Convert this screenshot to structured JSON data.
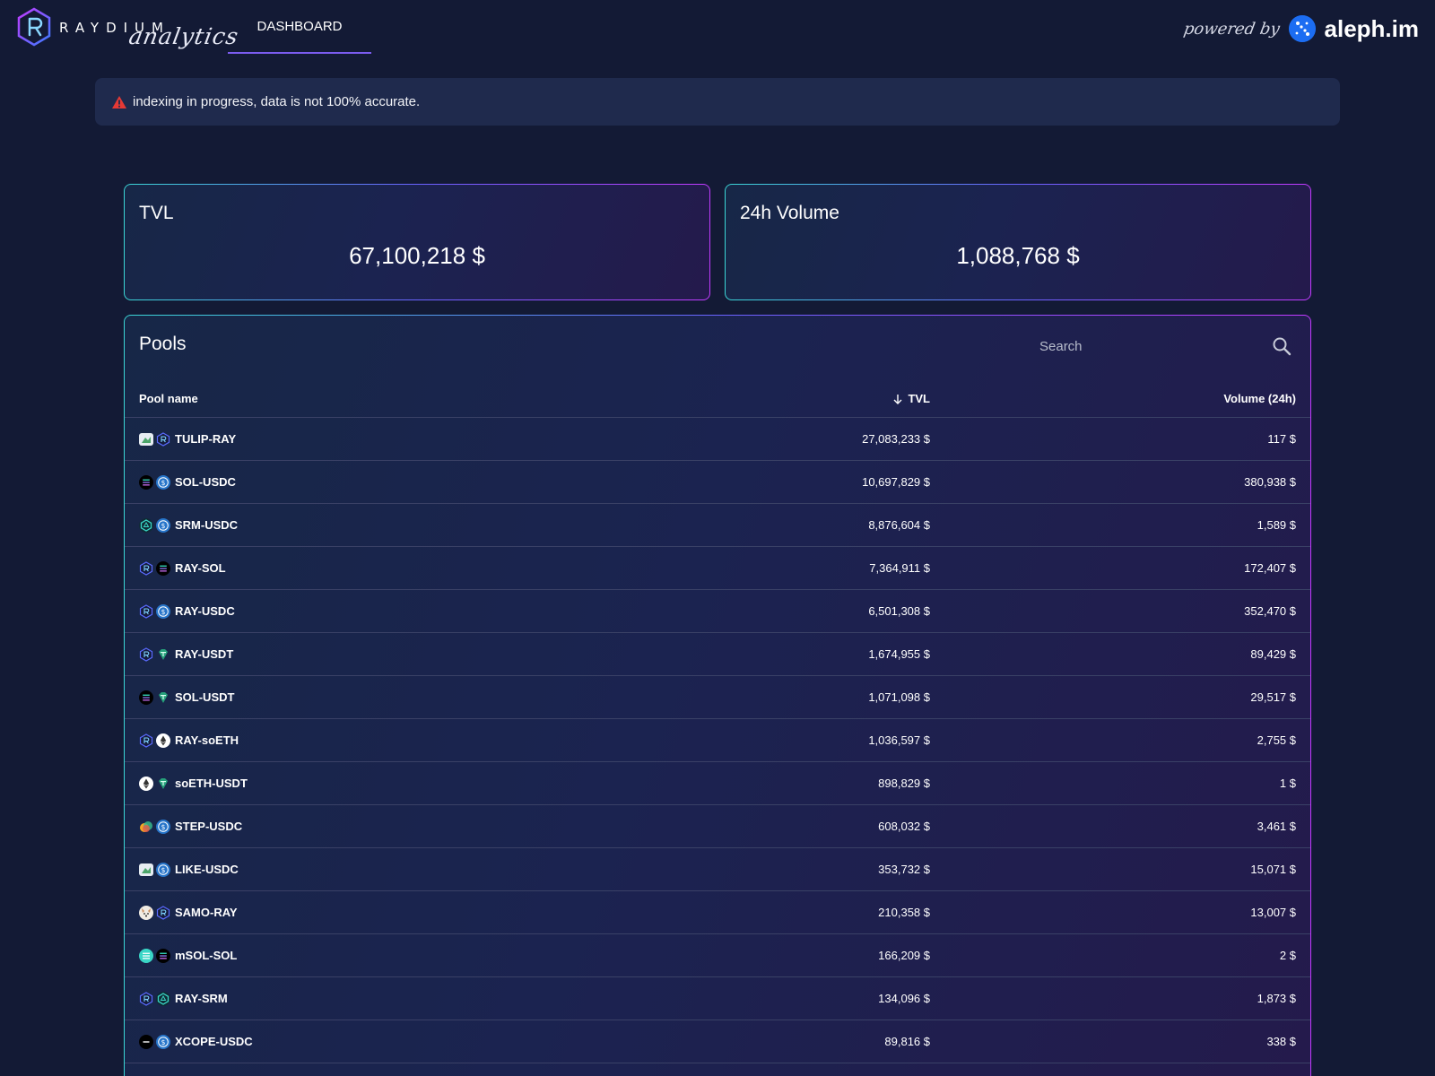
{
  "header": {
    "logo_word": "RAYDIUM",
    "logo_script": "analytics",
    "tab_label": "DASHBOARD",
    "powered_by": "powered by",
    "partner": "aleph.im"
  },
  "alert": {
    "icon": "warning-icon",
    "text": "indexing in progress, data is not 100% accurate."
  },
  "stats": {
    "tvl": {
      "label": "TVL",
      "value": "67,100,218 $"
    },
    "volume": {
      "label": "24h Volume",
      "value": "1,088,768 $"
    }
  },
  "pools": {
    "title": "Pools",
    "search_placeholder": "Search",
    "columns": {
      "name": "Pool name",
      "tvl": "TVL",
      "volume": "Volume (24h)"
    },
    "sort": {
      "column": "tvl",
      "direction": "descending"
    },
    "rows": [
      {
        "name": "TULIP-RAY",
        "tvl": "27,083,233 $",
        "volume": "117 $",
        "icons": [
          "tulip-icon",
          "ray-icon"
        ]
      },
      {
        "name": "SOL-USDC",
        "tvl": "10,697,829 $",
        "volume": "380,938 $",
        "icons": [
          "sol-icon",
          "usdc-icon"
        ]
      },
      {
        "name": "SRM-USDC",
        "tvl": "8,876,604 $",
        "volume": "1,589 $",
        "icons": [
          "srm-icon",
          "usdc-icon"
        ]
      },
      {
        "name": "RAY-SOL",
        "tvl": "7,364,911 $",
        "volume": "172,407 $",
        "icons": [
          "ray-icon",
          "sol-icon"
        ]
      },
      {
        "name": "RAY-USDC",
        "tvl": "6,501,308 $",
        "volume": "352,470 $",
        "icons": [
          "ray-icon",
          "usdc-icon"
        ]
      },
      {
        "name": "RAY-USDT",
        "tvl": "1,674,955 $",
        "volume": "89,429 $",
        "icons": [
          "ray-icon",
          "usdt-icon"
        ]
      },
      {
        "name": "SOL-USDT",
        "tvl": "1,071,098 $",
        "volume": "29,517 $",
        "icons": [
          "sol-icon",
          "usdt-icon"
        ]
      },
      {
        "name": "RAY-soETH",
        "tvl": "1,036,597 $",
        "volume": "2,755 $",
        "icons": [
          "ray-icon",
          "eth-icon"
        ]
      },
      {
        "name": "soETH-USDT",
        "tvl": "898,829 $",
        "volume": "1 $",
        "icons": [
          "eth-icon",
          "usdt-icon"
        ]
      },
      {
        "name": "STEP-USDC",
        "tvl": "608,032 $",
        "volume": "3,461 $",
        "icons": [
          "step-icon",
          "usdc-icon"
        ]
      },
      {
        "name": "LIKE-USDC",
        "tvl": "353,732 $",
        "volume": "15,071 $",
        "icons": [
          "like-icon",
          "usdc-icon"
        ]
      },
      {
        "name": "SAMO-RAY",
        "tvl": "210,358 $",
        "volume": "13,007 $",
        "icons": [
          "samo-icon",
          "ray-icon"
        ]
      },
      {
        "name": "mSOL-SOL",
        "tvl": "166,209 $",
        "volume": "2 $",
        "icons": [
          "msol-icon",
          "sol-icon"
        ]
      },
      {
        "name": "RAY-SRM",
        "tvl": "134,096 $",
        "volume": "1,873 $",
        "icons": [
          "ray-icon",
          "srm-icon"
        ]
      },
      {
        "name": "XCOPE-USDC",
        "tvl": "89,816 $",
        "volume": "338 $",
        "icons": [
          "xcope-icon",
          "usdc-icon"
        ]
      },
      {
        "name": "",
        "tvl": "",
        "volume": "",
        "icons": []
      }
    ]
  },
  "colors": {
    "background": "#131a35",
    "accent": "#7b5cf0",
    "border_gradient": [
      "#3bd6d6",
      "#6a63ff",
      "#c23bff"
    ],
    "warning": "#e53935"
  }
}
